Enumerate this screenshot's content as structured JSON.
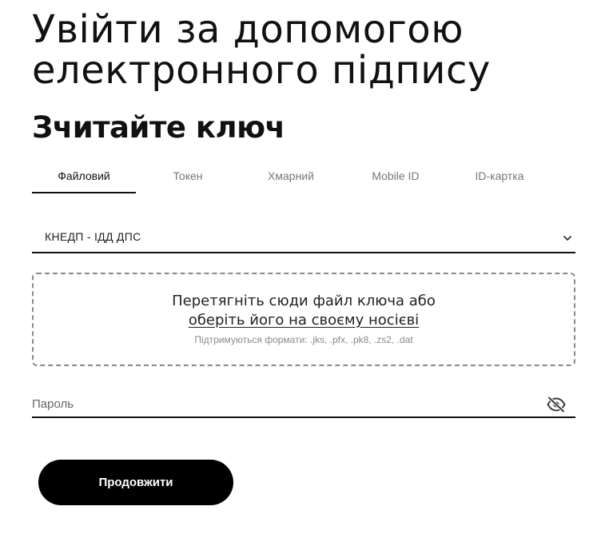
{
  "header": {
    "title_line1": "Увійти за допомогою",
    "title_line2": "електронного підпису",
    "subtitle": "Зчитайте ключ"
  },
  "tabs": [
    {
      "label": "Файловий",
      "active": true
    },
    {
      "label": "Токен",
      "active": false
    },
    {
      "label": "Хмарний",
      "active": false
    },
    {
      "label": "Mobile ID",
      "active": false
    },
    {
      "label": "ID-картка",
      "active": false
    }
  ],
  "provider_select": {
    "selected": "КНЕДП - ІДД ДПС",
    "icon": "chevron-down-icon"
  },
  "dropzone": {
    "line1": "Перетягніть сюди файл ключа або",
    "link": "оберіть його на своєму носієві",
    "formats": "Підтримуються формати: .jks, .pfx, .pk8, .zs2, .dat"
  },
  "password": {
    "placeholder": "Пароль",
    "value": "",
    "icon": "eye-off-icon"
  },
  "actions": {
    "continue_label": "Продовжити",
    "accent_color": "#000000"
  }
}
